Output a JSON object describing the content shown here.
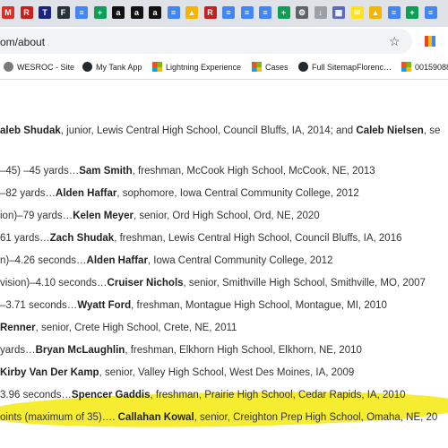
{
  "browser": {
    "tab_icons": [
      {
        "name": "gmail-tab-icon",
        "glyph": "M",
        "color": "#d93025"
      },
      {
        "name": "r-tab-icon",
        "glyph": "R",
        "color": "#c5221f"
      },
      {
        "name": "tsa-tab-icon",
        "glyph": "T",
        "color": "#1a237e"
      },
      {
        "name": "fr-tab-icon",
        "glyph": "F",
        "color": "#263238"
      },
      {
        "name": "docs-tab-icon",
        "glyph": "≡",
        "color": "#4285f4"
      },
      {
        "name": "plus-tab-icon",
        "glyph": "+",
        "color": "#0f9d58"
      },
      {
        "name": "amazon-tab-icon",
        "glyph": "a",
        "color": "#111111"
      },
      {
        "name": "amazon-tab-icon-2",
        "glyph": "a",
        "color": "#111111"
      },
      {
        "name": "amazon-tab-icon-3",
        "glyph": "a",
        "color": "#111111"
      },
      {
        "name": "docs-tab-icon-2",
        "glyph": "≡",
        "color": "#4285f4"
      },
      {
        "name": "drive-tab-icon",
        "glyph": "▲",
        "color": "#f4b400"
      },
      {
        "name": "r-tab-icon-2",
        "glyph": "R",
        "color": "#c5221f"
      },
      {
        "name": "docs-tab-icon-3",
        "glyph": "≡",
        "color": "#4285f4"
      },
      {
        "name": "docs-tab-icon-4",
        "glyph": "≡",
        "color": "#4285f4"
      },
      {
        "name": "docs-tab-icon-5",
        "glyph": "≡",
        "color": "#4285f4"
      },
      {
        "name": "plus-tab-icon-2",
        "glyph": "+",
        "color": "#0f9d58"
      },
      {
        "name": "settings-tab-icon",
        "glyph": "⚙",
        "color": "#5f6368"
      },
      {
        "name": "pin-tab-icon",
        "glyph": "↓",
        "color": "#9aa0a6"
      },
      {
        "name": "calendar-tab-icon",
        "glyph": "▦",
        "color": "#5c6bc0"
      },
      {
        "name": "mailchimp-tab-icon",
        "glyph": "✉",
        "color": "#ffe01b"
      },
      {
        "name": "drive-tab-icon-2",
        "glyph": "▲",
        "color": "#f4b400"
      },
      {
        "name": "docs-tab-icon-6",
        "glyph": "≡",
        "color": "#4285f4"
      },
      {
        "name": "plus-tab-icon-3",
        "glyph": "+",
        "color": "#0f9d58"
      },
      {
        "name": "docs-tab-icon-7",
        "glyph": "≡",
        "color": "#4285f4"
      }
    ],
    "url": "om/about",
    "bookmarks": [
      {
        "label": "WESROC - Site",
        "icon": "flower-icon"
      },
      {
        "label": "My Tank App",
        "icon": "github-icon"
      },
      {
        "label": "Lightning Experience",
        "icon": "microsoft-icon"
      },
      {
        "label": "Cases",
        "icon": "microsoft-icon"
      },
      {
        "label": "Full SitemapFlorenc…",
        "icon": "github-icon"
      },
      {
        "label": "00159088",
        "icon": "microsoft-icon"
      }
    ]
  },
  "records": [
    [
      {
        "t": "aleb Shudak"
      },
      {
        "n": ", junior, Lewis Central High School, Council Bluffs, IA, 2014; and "
      },
      {
        "t": "Caleb Nielsen"
      },
      {
        "n": ", se"
      }
    ],
    [
      {
        "n": "–45) –45 yards…"
      },
      {
        "t": "Sam Smith"
      },
      {
        "n": ", freshman, McCook High School, McCook, NE, 2013"
      }
    ],
    [
      {
        "n": "–82 yards…"
      },
      {
        "t": "Alden Haffar"
      },
      {
        "n": ", sophomore, Iowa Central Community College, 2012"
      }
    ],
    [
      {
        "n": "ion)–79 yards…"
      },
      {
        "t": "Kelen Meyer"
      },
      {
        "n": ", senior, Ord High School, Ord, NE, 2020"
      }
    ],
    [
      {
        "n": "61 yards…"
      },
      {
        "t": "Zach Shudak"
      },
      {
        "n": ", freshman, Lewis Central High School, Council Bluffs, IA, 2016"
      }
    ],
    [
      {
        "n": "n)–4.26 seconds…"
      },
      {
        "t": "Alden Haffar"
      },
      {
        "n": ", Iowa Central Community College, 2012"
      }
    ],
    [
      {
        "n": "vision)–4.10 seconds…"
      },
      {
        "t": "Cruiser Nichols"
      },
      {
        "n": ", senior, Smithville High School, Smithville, MO, 2007"
      }
    ],
    [
      {
        "n": "–3.71 seconds…"
      },
      {
        "t": "Wyatt Ford"
      },
      {
        "n": ", freshman, Montague High School, Montague, MI, 2010"
      }
    ],
    [
      {
        "t": "Renner"
      },
      {
        "n": ", senior, Crete High School, Crete, NE, 2011"
      }
    ],
    [
      {
        "n": "yards…"
      },
      {
        "t": "Bryan McLaughlin"
      },
      {
        "n": ", freshman, Elkhorn High School, Elkhorn, NE, 2010"
      }
    ],
    [
      {
        "t": "Kirby Van Der Kamp"
      },
      {
        "n": ", senior, Valley High School, West Des Moines, IA, 2009"
      }
    ],
    [
      {
        "n": "3.96 seconds…"
      },
      {
        "t": "Spencer Gaddis"
      },
      {
        "n": ", freshman, Prairie High School, Cedar Rapids, IA, 2010"
      }
    ],
    [
      {
        "n": "oints (maximum of 35)…. "
      },
      {
        "t": "Callahan Kowal"
      },
      {
        "n": ", senior, Creighton Prep High School, Omaha, NE, 20"
      }
    ]
  ]
}
